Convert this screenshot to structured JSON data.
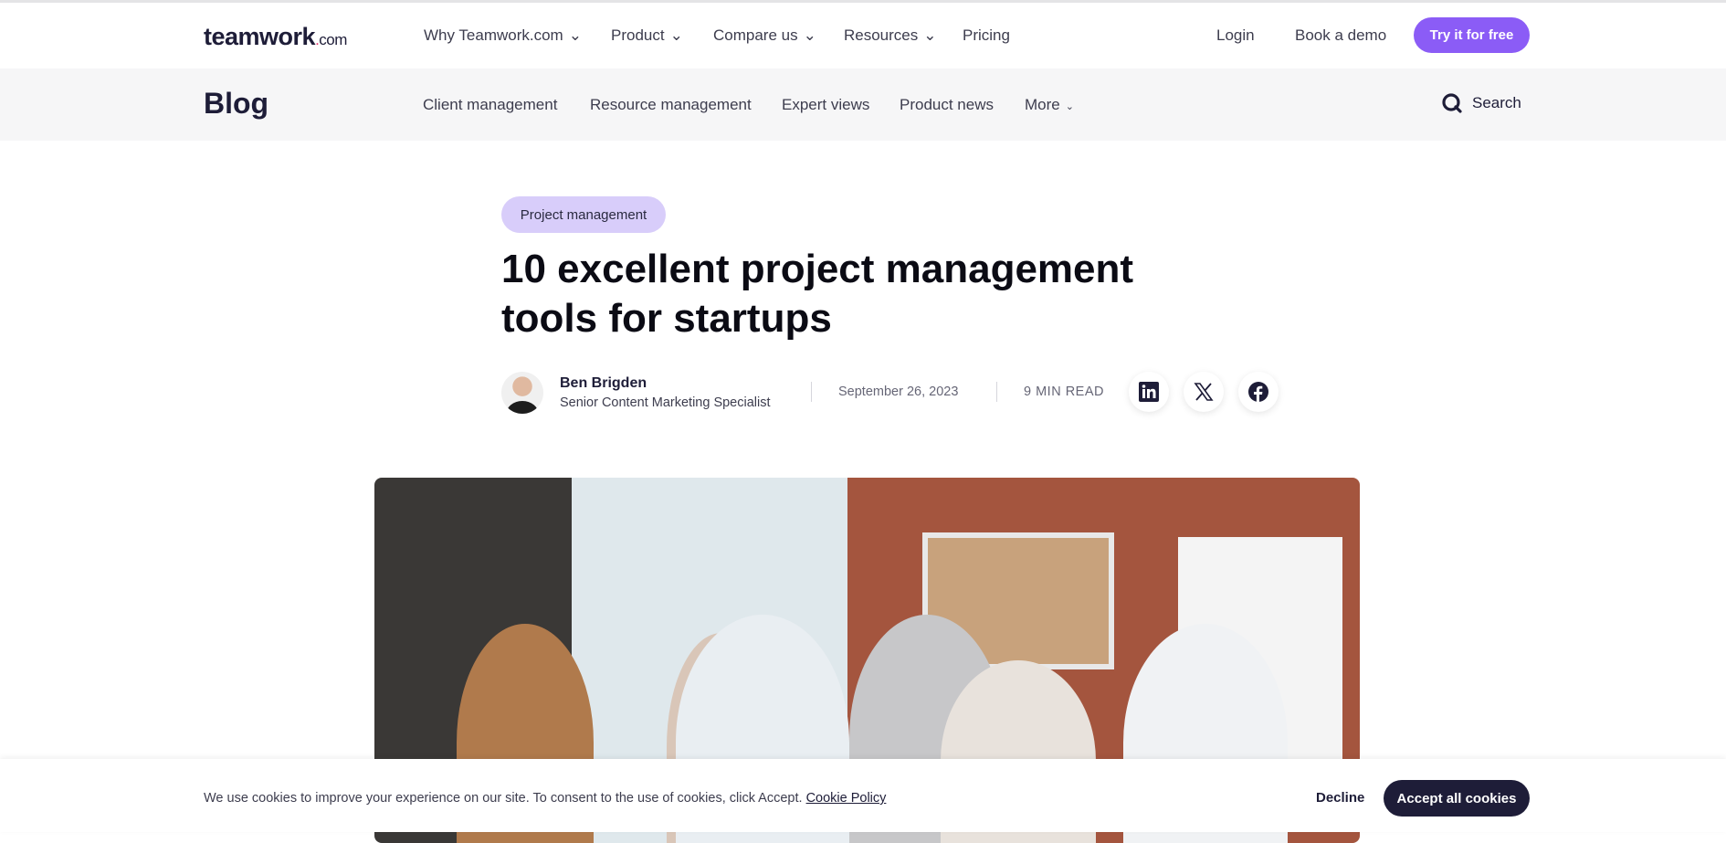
{
  "header": {
    "logo": "teamwork",
    "logo_suffix": ".com",
    "nav": [
      {
        "label": "Why Teamwork.com",
        "dropdown": true
      },
      {
        "label": "Product",
        "dropdown": true
      },
      {
        "label": "Compare us",
        "dropdown": true
      },
      {
        "label": "Resources",
        "dropdown": true
      },
      {
        "label": "Pricing",
        "dropdown": false
      }
    ],
    "login": "Login",
    "demo": "Book a demo",
    "try": "Try it for free"
  },
  "blogbar": {
    "title": "Blog",
    "links": [
      "Client management",
      "Resource management",
      "Expert views",
      "Product news",
      "More"
    ],
    "search": "Search"
  },
  "article": {
    "category": "Project management",
    "title": "10 excellent project management tools for startups",
    "author": "Ben Brigden",
    "role": "Senior Content Marketing Specialist",
    "date": "September 26, 2023",
    "read_time": "9 MIN READ",
    "social": [
      "linkedin-icon",
      "x-icon",
      "facebook-icon"
    ]
  },
  "cookie": {
    "text": "We use cookies to improve your experience on our site. To consent to the use of cookies, click Accept.",
    "policy": "Cookie Policy",
    "decline": "Decline",
    "accept": "Accept all cookies"
  },
  "colors": {
    "accent": "#8b5cf6",
    "pill": "#d8cdfa",
    "dark": "#1e1d38"
  }
}
